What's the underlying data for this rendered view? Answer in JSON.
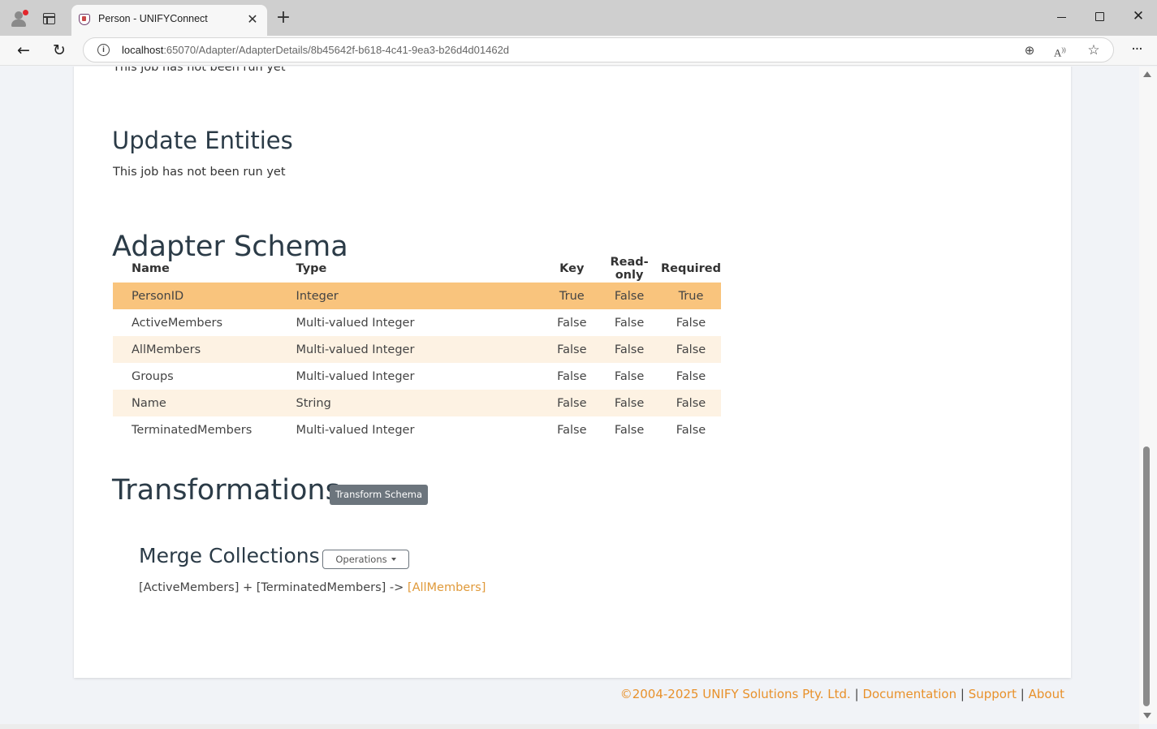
{
  "browser": {
    "tab_title": "Person - UNIFYConnect",
    "tab_close": "✕",
    "new_tab": "+",
    "url_host": "localhost",
    "url_rest": ":65070/Adapter/AdapterDetails/8b45642f-b618-4c41-9ea3-b26d4d01462d",
    "window_close": "✕"
  },
  "page": {
    "top_status": "This job has not been run yet",
    "update_entities": {
      "heading": "Update Entities",
      "status": "This job has not been run yet"
    },
    "adapter_schema": {
      "heading": "Adapter Schema",
      "columns": [
        "Name",
        "Type",
        "Key",
        "Read-only",
        "Required"
      ],
      "rows": [
        {
          "name": "PersonID",
          "type": "Integer",
          "key": "True",
          "readonly": "False",
          "required": "True"
        },
        {
          "name": "ActiveMembers",
          "type": "Multi-valued Integer",
          "key": "False",
          "readonly": "False",
          "required": "False"
        },
        {
          "name": "AllMembers",
          "type": "Multi-valued Integer",
          "key": "False",
          "readonly": "False",
          "required": "False"
        },
        {
          "name": "Groups",
          "type": "Multi-valued Integer",
          "key": "False",
          "readonly": "False",
          "required": "False"
        },
        {
          "name": "Name",
          "type": "String",
          "key": "False",
          "readonly": "False",
          "required": "False"
        },
        {
          "name": "TerminatedMembers",
          "type": "Multi-valued Integer",
          "key": "False",
          "readonly": "False",
          "required": "False"
        }
      ]
    },
    "transformations": {
      "heading": "Transformations",
      "transform_button": "Transform Schema",
      "merge": {
        "heading": "Merge Collections",
        "operations_button": "Operations",
        "expression": "[ActiveMembers] + [TerminatedMembers] -> ",
        "target_link": "[AllMembers]"
      }
    }
  },
  "footer": {
    "copyright": "©2004-2025 UNIFY Solutions Pty. Ltd.",
    "separator": "|",
    "documentation": "Documentation",
    "support": "Support",
    "about": "About"
  },
  "colors": {
    "accent": "#e8912b",
    "selected_row": "#f9c47d",
    "striped_row": "#fdf2e3",
    "secondary_button": "#6c757d"
  }
}
